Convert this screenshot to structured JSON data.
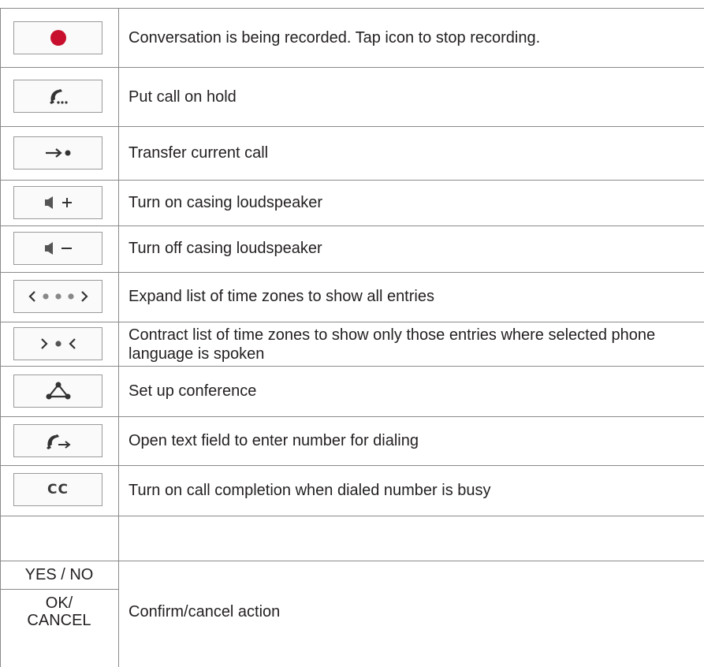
{
  "rows": [
    {
      "icon": "record-icon",
      "description": "Conversation is being recorded.  Tap icon to stop recording."
    },
    {
      "icon": "hold-call-icon",
      "description": "Put call on hold"
    },
    {
      "icon": "transfer-call-icon",
      "glyph": "→•",
      "description": "Transfer current call"
    },
    {
      "icon": "speaker-on-icon",
      "glyph": "+",
      "description": "Turn on casing loudspeaker"
    },
    {
      "icon": "speaker-off-icon",
      "glyph": "−",
      "description": "Turn off casing loudspeaker"
    },
    {
      "icon": "expand-list-icon",
      "glyph": "〈•••〉",
      "description": "Expand list of time zones to show all entries"
    },
    {
      "icon": "contract-list-icon",
      "glyph": "〉•〈",
      "description": "Contract list of time zones to show only those entries where selected phone language is spoken"
    },
    {
      "icon": "conference-icon",
      "description": "Set up conference"
    },
    {
      "icon": "dial-number-icon",
      "description": "Open text field to enter number for dialing"
    },
    {
      "icon": "call-completion-icon",
      "glyph": "CC",
      "description": "Turn on call completion when dialed number is busy"
    }
  ],
  "final_row": {
    "yes_no": "YES / NO",
    "ok_cancel_line1": "OK/",
    "ok_cancel_line2": "CANCEL",
    "description": "Confirm/cancel action"
  },
  "colors": {
    "record": "#c8102e",
    "border": "#8a8a8a",
    "text": "#231f20"
  }
}
